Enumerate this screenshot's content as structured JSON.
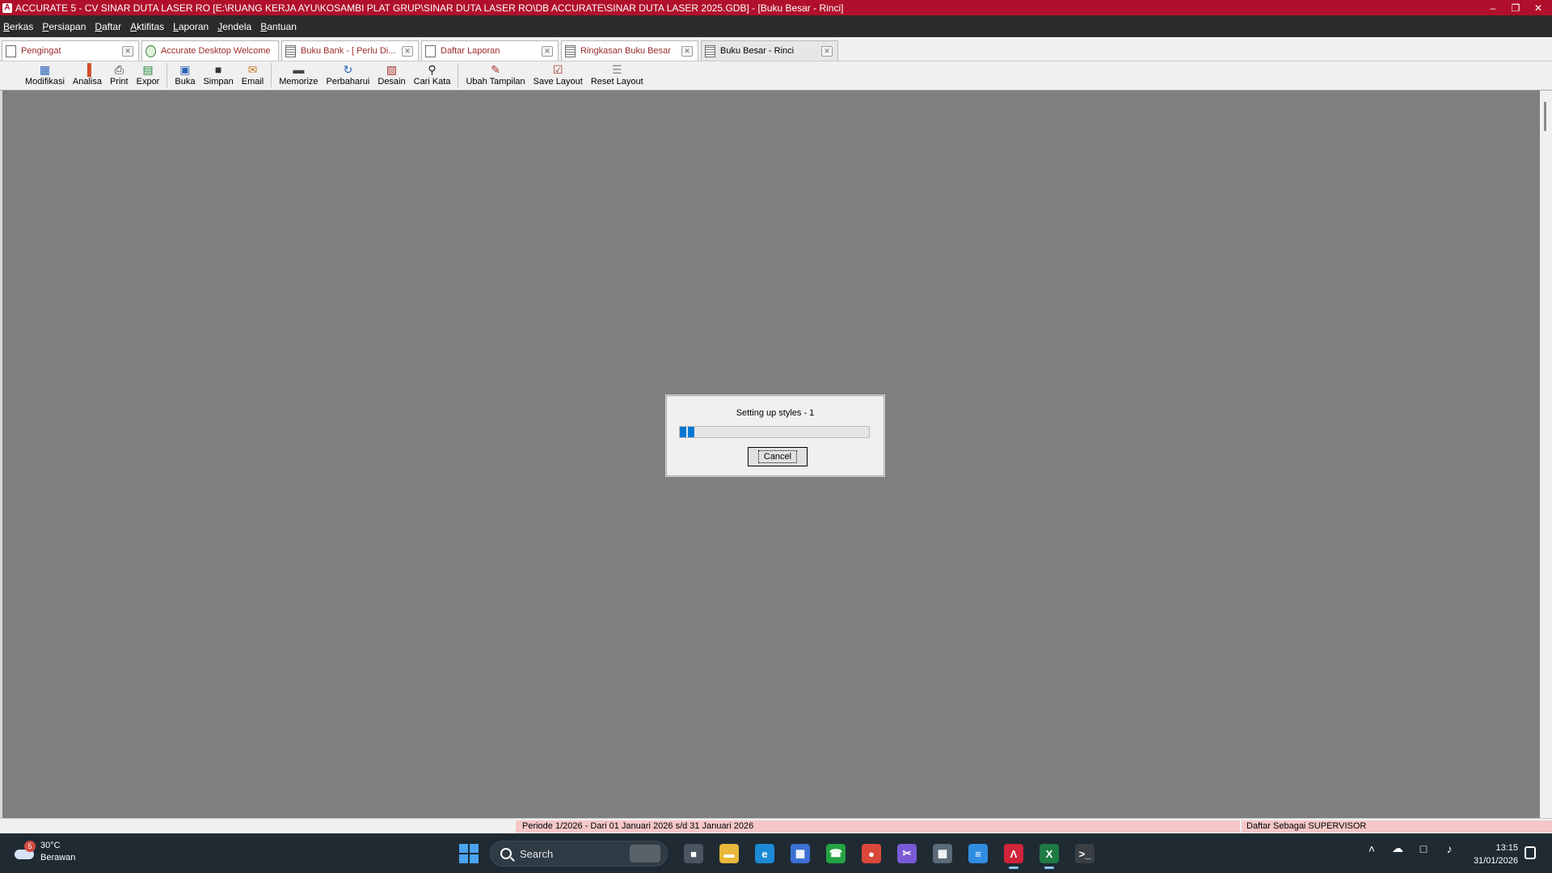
{
  "window": {
    "title": "ACCURATE 5 - CV SINAR DUTA LASER RO   [E:\\RUANG KERJA AYU\\KOSAMBI PLAT GRUP\\SINAR DUTA LASER RO\\DB ACCURATE\\SINAR DUTA LASER 2025.GDB] - [Buku Besar - Rinci]",
    "app_icon_label": "A",
    "controls": {
      "minimize": "–",
      "restore": "❐",
      "close": "✕"
    },
    "accent_color": "#b0102b"
  },
  "menu": [
    "Berkas",
    "Persiapan",
    "Daftar",
    "Aktifitas",
    "Laporan",
    "Jendela",
    "Bantuan"
  ],
  "tabs": [
    {
      "label": "Pengingat",
      "icon": "page-icon",
      "active": false
    },
    {
      "label": "Accurate Desktop Welcome",
      "icon": "globe-icon",
      "active": false
    },
    {
      "label": "Buku Bank - [ Perlu Di...",
      "icon": "grid-icon",
      "active": false
    },
    {
      "label": "Daftar Laporan",
      "icon": "page-icon",
      "active": false
    },
    {
      "label": "Ringkasan Buku Besar",
      "icon": "report-icon",
      "active": false
    },
    {
      "label": "Buku Besar - Rinci",
      "icon": "report-icon",
      "active": true
    }
  ],
  "toolbar": {
    "group1": [
      {
        "label": "Modifikasi",
        "icon": "modify-icon",
        "glyph": "▦",
        "color": "#2a62b8"
      },
      {
        "label": "Analisa",
        "icon": "chart-icon",
        "glyph": "▐",
        "color": "#d24a2a"
      },
      {
        "label": "Print",
        "icon": "printer-icon",
        "glyph": "⎙",
        "color": "#333"
      },
      {
        "label": "Expor",
        "icon": "export-icon",
        "glyph": "▤",
        "color": "#1f8a3b"
      }
    ],
    "group2": [
      {
        "label": "Buka",
        "icon": "open-icon",
        "glyph": "▣",
        "color": "#2a62b8"
      },
      {
        "label": "Simpan",
        "icon": "save-icon",
        "glyph": "■",
        "color": "#333"
      },
      {
        "label": "Email",
        "icon": "email-icon",
        "glyph": "✉",
        "color": "#c77b1a"
      }
    ],
    "group3": [
      {
        "label": "Memorize",
        "icon": "memorize-icon",
        "glyph": "▬",
        "color": "#444"
      },
      {
        "label": "Perbaharui",
        "icon": "refresh-icon",
        "glyph": "↻",
        "color": "#2a62b8"
      },
      {
        "label": "Desain",
        "icon": "design-icon",
        "glyph": "▧",
        "color": "#a33"
      },
      {
        "label": "Cari Kata",
        "icon": "search-icon",
        "glyph": "⚲",
        "color": "#222"
      }
    ],
    "group4": [
      {
        "label": "Ubah Tampilan",
        "icon": "edit-icon",
        "glyph": "✎",
        "color": "#a33"
      },
      {
        "label": "Save Layout",
        "icon": "check-icon",
        "glyph": "☑",
        "color": "#a33"
      },
      {
        "label": "Reset Layout",
        "icon": "reset-icon",
        "glyph": "☰",
        "color": "#888"
      }
    ]
  },
  "dialog": {
    "message": "Setting up styles - 1",
    "progress_fraction": 0.08,
    "progress_color": "#0678d4",
    "cancel_label": "Cancel"
  },
  "status": {
    "period": "Periode 1/2026 - Dari 01 Januari 2026 s/d 31 Januari 2026",
    "user": "Daftar Sebagai SUPERVISOR"
  },
  "taskbar": {
    "weather": {
      "temp": "30°C",
      "condition": "Berawan",
      "badge": "5"
    },
    "search_label": "Search",
    "apps": [
      {
        "name": "task-view-icon",
        "glyph": "■",
        "color": "#4a5560"
      },
      {
        "name": "file-explorer-icon",
        "glyph": "▬",
        "color": "#e8b83a"
      },
      {
        "name": "edge-icon",
        "glyph": "e",
        "color": "#1c8ad6"
      },
      {
        "name": "store-icon",
        "glyph": "▦",
        "color": "#3d6fd6"
      },
      {
        "name": "whatsapp-icon",
        "glyph": "☎",
        "color": "#25a244"
      },
      {
        "name": "chrome-icon",
        "glyph": "●",
        "color": "#d9483b"
      },
      {
        "name": "snipping-icon",
        "glyph": "✂",
        "color": "#7a5ad6"
      },
      {
        "name": "calculator-icon",
        "glyph": "▦",
        "color": "#5b6a78"
      },
      {
        "name": "notepad-icon",
        "glyph": "≡",
        "color": "#2f8de0"
      },
      {
        "name": "accurate-icon",
        "glyph": "Λ",
        "color": "#d0243a",
        "active": true
      },
      {
        "name": "excel-icon",
        "glyph": "X",
        "color": "#1f7a44",
        "active": true
      },
      {
        "name": "terminal-icon",
        "glyph": ">_",
        "color": "#3a3f44"
      }
    ],
    "tray": [
      "˄",
      "☁",
      "□",
      "♪"
    ],
    "time": "13:15",
    "date": "31/01/2026"
  }
}
